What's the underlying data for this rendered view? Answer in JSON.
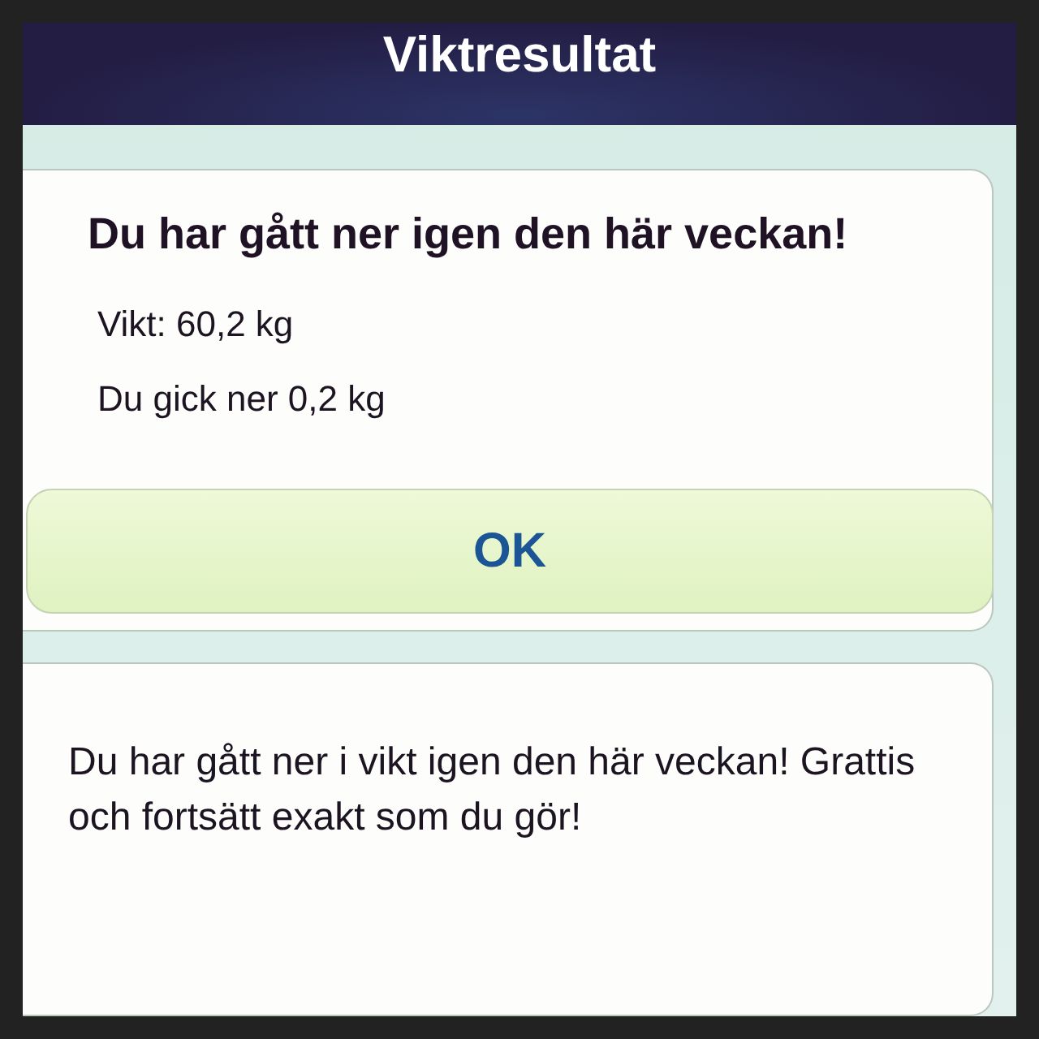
{
  "header": {
    "title": "Viktresultat"
  },
  "result_card": {
    "heading": "Du har gått ner igen den här veckan!",
    "lines": [
      "Vikt: 60,2 kg",
      "Du gick ner 0,2 kg"
    ],
    "button": "OK"
  },
  "message_card": {
    "text": "Du har gått ner i vikt igen den här veckan! Grattis och fortsätt exakt som du gör!"
  }
}
